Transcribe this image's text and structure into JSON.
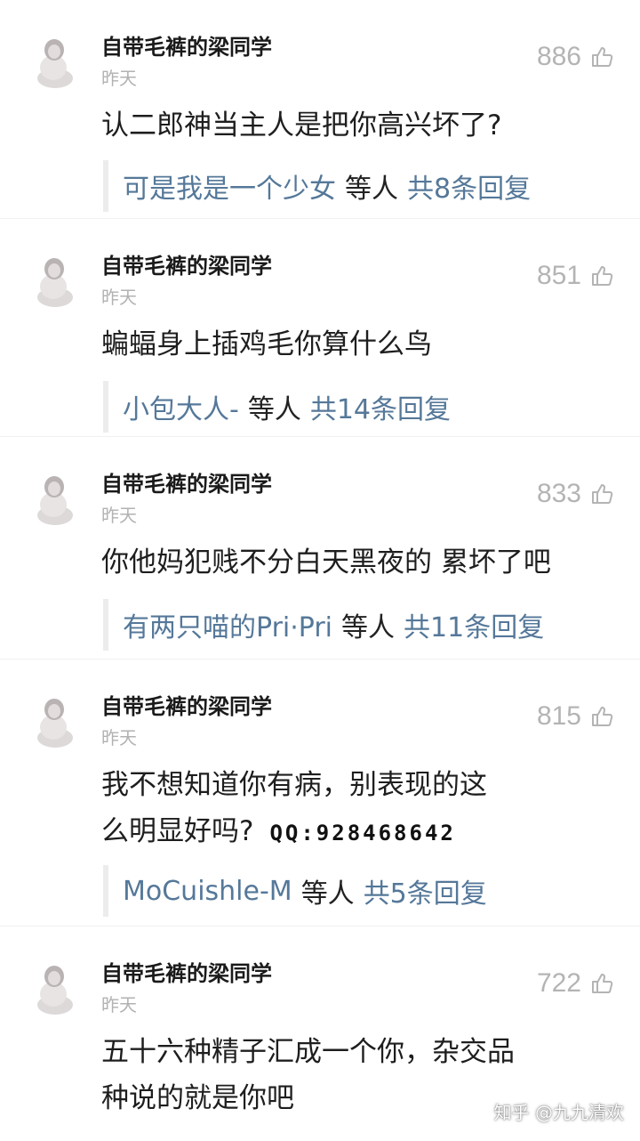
{
  "comments": [
    {
      "author": "自带毛裤的梁同学",
      "time": "昨天",
      "likes": "886",
      "text": [
        "认二郎神当主人是把你高兴坏了?"
      ],
      "qq": "",
      "reply_user": "可是我是一个少女",
      "reply_etc": "等人",
      "reply_total": "共8条回复"
    },
    {
      "author": "自带毛裤的梁同学",
      "time": "昨天",
      "likes": "851",
      "text": [
        "蝙蝠身上插鸡毛你算什么鸟"
      ],
      "qq": "",
      "reply_user": "小包大人-",
      "reply_etc": "等人",
      "reply_total": "共14条回复"
    },
    {
      "author": "自带毛裤的梁同学",
      "time": "昨天",
      "likes": "833",
      "text": [
        "你他妈犯贱不分白天黑夜的 累坏了吧"
      ],
      "qq": "",
      "reply_user": "有两只喵的Pri·Pri",
      "reply_etc": "等人",
      "reply_total": "共11条回复"
    },
    {
      "author": "自带毛裤的梁同学",
      "time": "昨天",
      "likes": "815",
      "text": [
        "我不想知道你有病，别表现的这",
        "么明显好吗?"
      ],
      "qq": "QQ:928468642",
      "reply_user": "MoCuishle-M",
      "reply_etc": "等人",
      "reply_total": "共5条回复"
    },
    {
      "author": "自带毛裤的梁同学",
      "time": "昨天",
      "likes": "722",
      "text": [
        "五十六种精子汇成一个你，杂交品",
        "种说的就是你吧"
      ],
      "qq": "",
      "reply_user": "",
      "reply_etc": "",
      "reply_total": ""
    }
  ],
  "watermark": "知乎 @九九清欢",
  "colors": {
    "link": "#557899",
    "muted": "#b4b4b4",
    "text": "#1e1e1e"
  },
  "icons": {
    "like": "thumbs-up-icon",
    "avatar": "user-avatar"
  }
}
